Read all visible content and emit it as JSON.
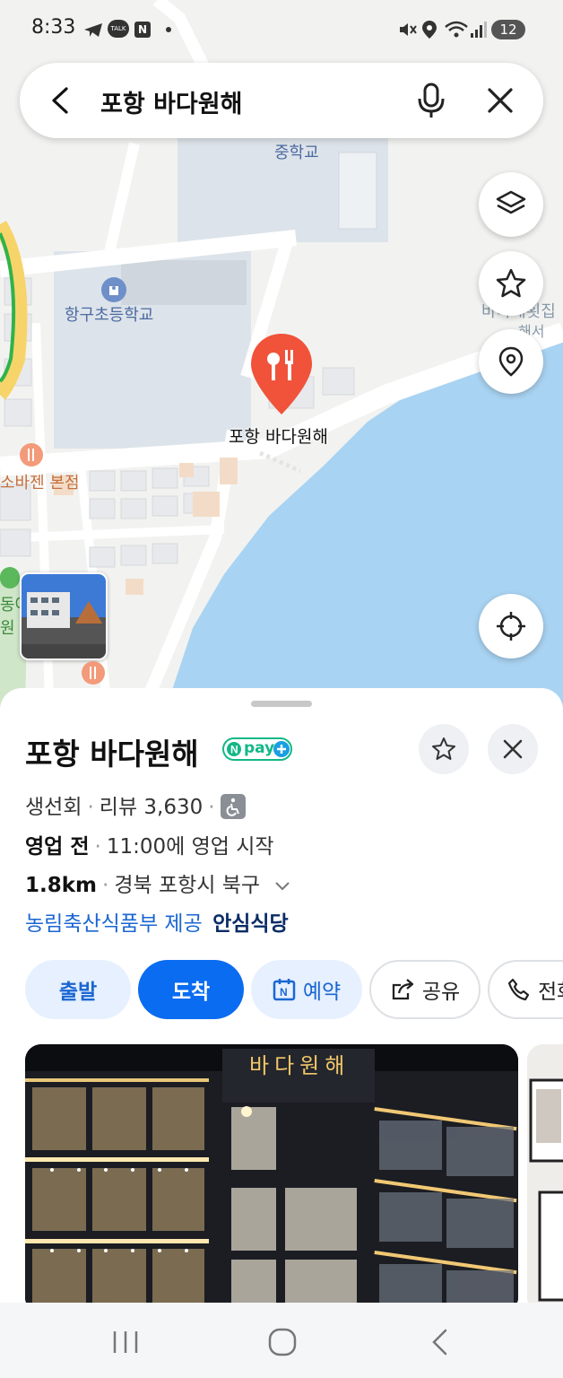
{
  "status_bar": {
    "time": "8:33",
    "talk_badge": "TALK",
    "n_badge": "N",
    "battery": "12"
  },
  "search": {
    "query": "포항 바다원해"
  },
  "map": {
    "labels": {
      "middle_school": "중학교",
      "elementary_school": "항구초등학교",
      "place_pin": "포항 바다원해",
      "restaurant_left": "소바젠 본점",
      "right_partial_1": "바다해횟집",
      "right_partial_2": "해서",
      "left_partial_1": "동어",
      "left_partial_2": "원"
    },
    "colors": {
      "water": "#a9d3f2",
      "block": "#dde3ea",
      "pin": "#f0533a"
    }
  },
  "place": {
    "name": "포항 바다원해",
    "npay_label": "pay",
    "category": "생선회",
    "review_label": "리뷰 3,630",
    "status": "영업 전",
    "hours": "11:00에 영업 시작",
    "distance": "1.8km",
    "address": "경북 포항시 북구",
    "safe_provider": "농림축산식품부 제공",
    "safe_label": "안심식당"
  },
  "actions": {
    "depart": "출발",
    "arrive": "도착",
    "reserve": "예약",
    "share": "공유",
    "call": "전화"
  },
  "photos": {
    "sign_text": "바다원해"
  }
}
